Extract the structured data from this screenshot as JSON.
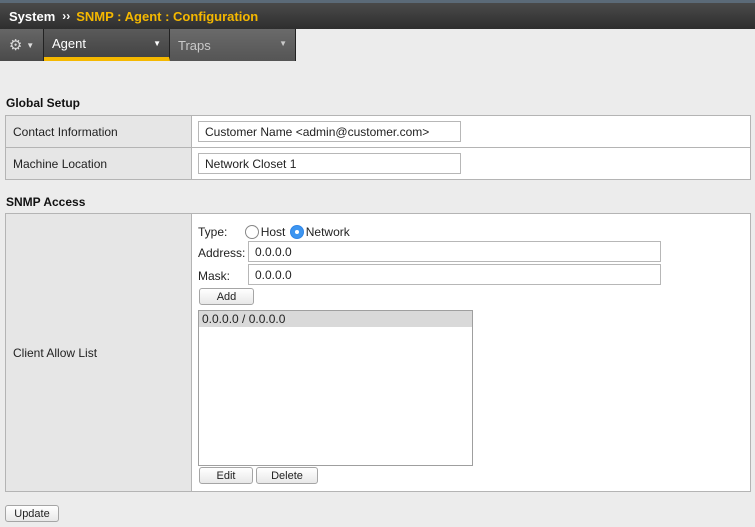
{
  "breadcrumb": {
    "root": "System",
    "separator": "››",
    "path": "SNMP : Agent : Configuration"
  },
  "tabs": [
    {
      "label": "Agent",
      "active": true
    },
    {
      "label": "Traps",
      "active": false
    }
  ],
  "global_setup": {
    "title": "Global Setup",
    "contact_label": "Contact Information",
    "contact_value": "Customer Name <admin@customer.com>",
    "location_label": "Machine Location",
    "location_value": "Network Closet 1"
  },
  "snmp_access": {
    "title": "SNMP Access",
    "client_allow_label": "Client Allow List",
    "type_label": "Type:",
    "type_options": [
      "Host",
      "Network"
    ],
    "type_selected": "Network",
    "address_label": "Address:",
    "address_value": "0.0.0.0",
    "mask_label": "Mask:",
    "mask_value": "0.0.0.0",
    "add_label": "Add",
    "list_items": [
      "0.0.0.0 / 0.0.0.0"
    ],
    "edit_label": "Edit",
    "delete_label": "Delete"
  },
  "update_label": "Update",
  "colors": {
    "accent": "#f5b800",
    "radio_selected": "#3d95f0"
  }
}
